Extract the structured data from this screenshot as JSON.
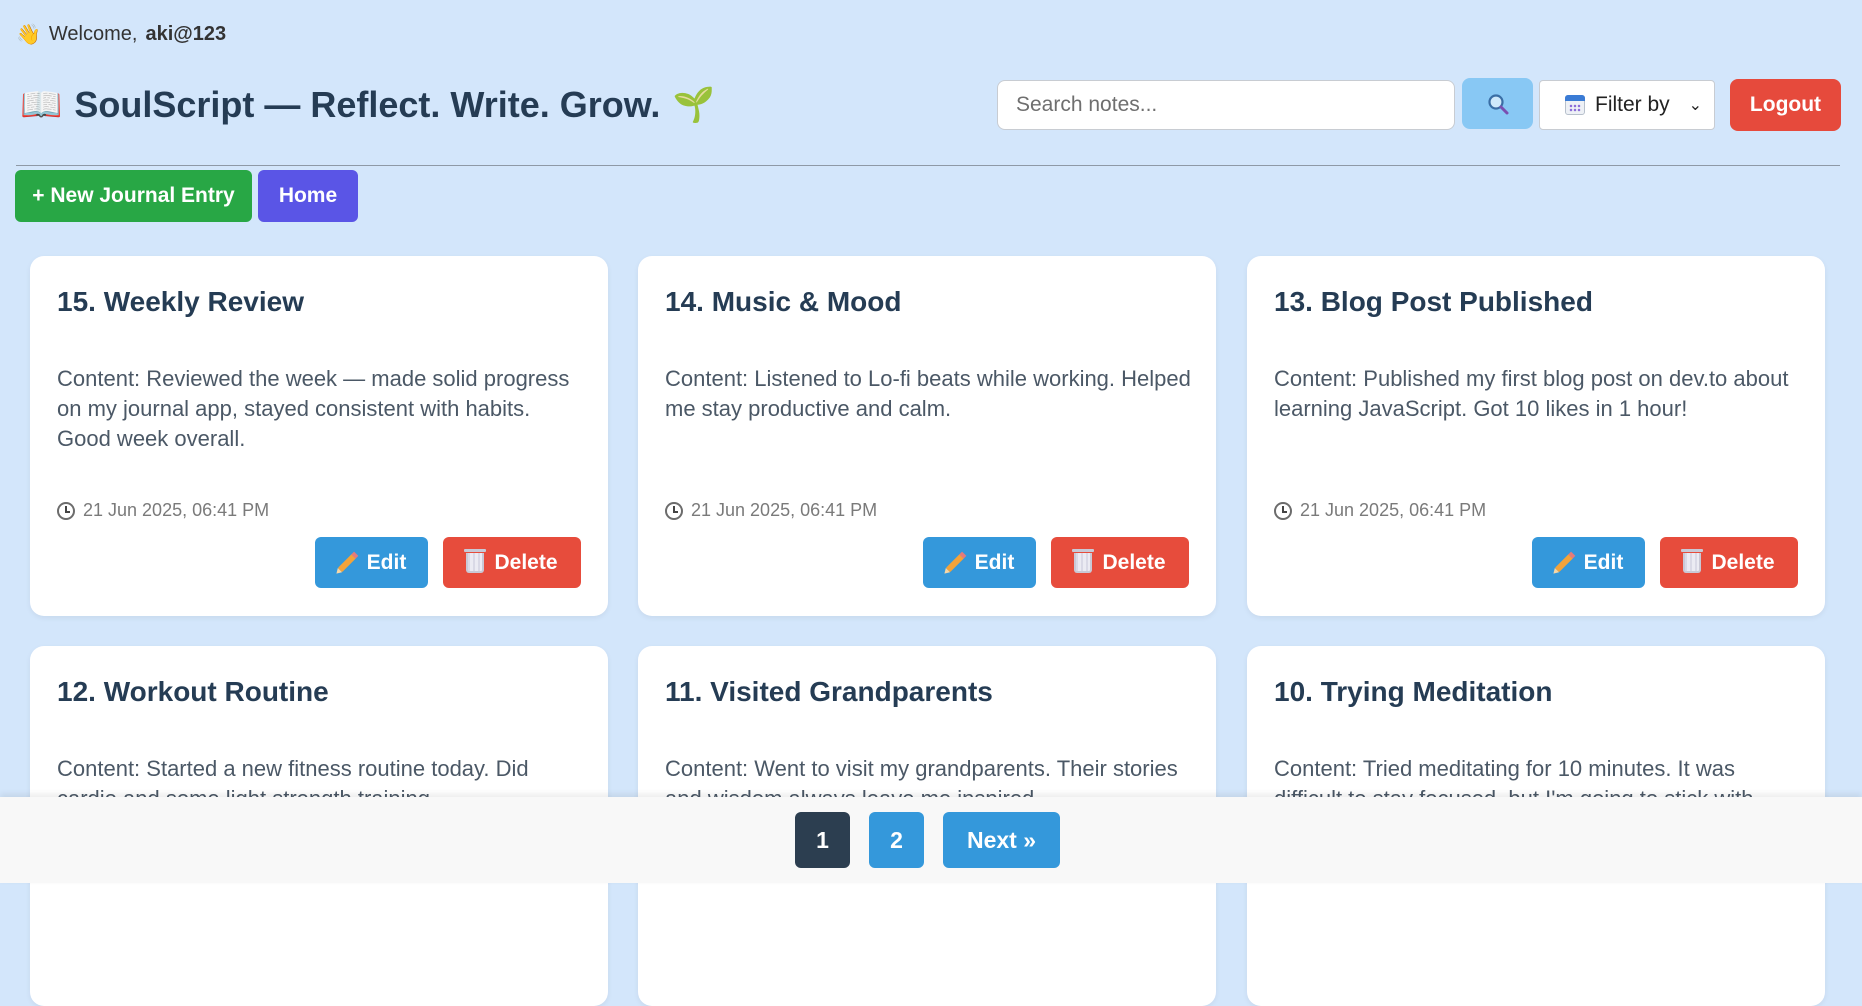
{
  "header": {
    "welcome_prefix": "Welcome,",
    "username": "aki@123",
    "title": "SoulScript — Reflect. Write. Grow.",
    "search_placeholder": "Search notes...",
    "filter_label": "Filter by",
    "logout_label": "Logout"
  },
  "actions": {
    "new_entry_label": "+ New Journal Entry",
    "home_label": "Home"
  },
  "cards": [
    {
      "title": "15. Weekly Review",
      "content": "Content: Reviewed the week — made solid progress on my journal app, stayed consistent with habits. Good week overall.",
      "date": "21 Jun 2025, 06:41 PM",
      "edit_label": "Edit",
      "delete_label": "Delete"
    },
    {
      "title": "14. Music & Mood",
      "content": "Content: Listened to Lo-fi beats while working. Helped me stay productive and calm.",
      "date": "21 Jun 2025, 06:41 PM",
      "edit_label": "Edit",
      "delete_label": "Delete"
    },
    {
      "title": "13. Blog Post Published",
      "content": "Content: Published my first blog post on dev.to about learning JavaScript. Got 10 likes in 1 hour!",
      "date": "21 Jun 2025, 06:41 PM",
      "edit_label": "Edit",
      "delete_label": "Delete"
    },
    {
      "title": "12. Workout Routine",
      "content": "Content: Started a new fitness routine today. Did cardio and some light strength training."
    },
    {
      "title": "11. Visited Grandparents",
      "content": "Content: Went to visit my grandparents. Their stories and wisdom always leave me inspired."
    },
    {
      "title": "10. Trying Meditation",
      "content": "Content: Tried meditating for 10 minutes. It was difficult to stay focused, but I'm going to stick with"
    }
  ],
  "pagination": {
    "page1": "1",
    "page2": "2",
    "next_label": "Next »"
  }
}
